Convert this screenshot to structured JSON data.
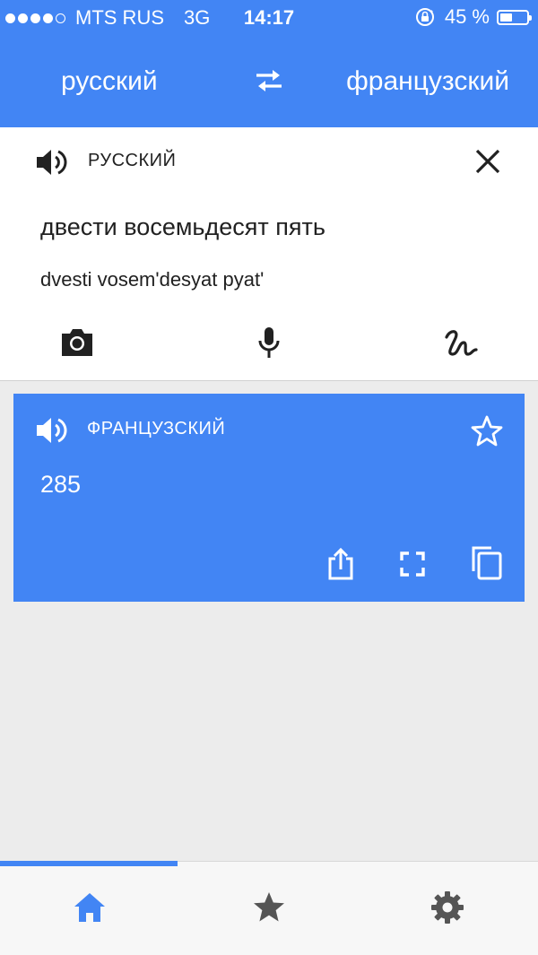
{
  "status": {
    "carrier": "MTS RUS",
    "network": "3G",
    "time": "14:17",
    "battery": "45 %",
    "battery_level": 0.45,
    "signal_bars": 4,
    "signal_total": 5
  },
  "header": {
    "source_lang": "русский",
    "target_lang": "французский"
  },
  "input": {
    "lang_label": "РУССКИЙ",
    "text": "двести восемьдесят пять",
    "transliteration": "dvesti vosem'desyat pyat'"
  },
  "result": {
    "lang_label": "ФРАНЦУЗСКИЙ",
    "text": "285"
  },
  "bottom_nav": {
    "active": "home",
    "progress": 0.33
  },
  "colors": {
    "accent": "#4285f4",
    "icon_dark": "#212121",
    "nav_inactive": "#555555"
  }
}
